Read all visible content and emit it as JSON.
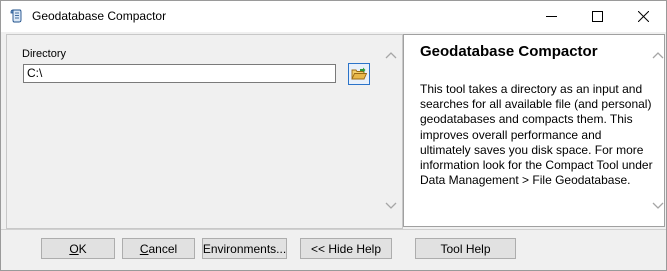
{
  "window": {
    "title": "Geodatabase Compactor",
    "controls": {
      "minimize": "minimize",
      "maximize": "maximize",
      "close": "close"
    }
  },
  "form": {
    "directory_label": "Directory",
    "directory_value": "C:\\",
    "browse_icon": "folder-open-icon"
  },
  "help": {
    "title": "Geodatabase Compactor",
    "body": "This tool takes a directory as an input and searches for all available file (and personal) geodatabases and compacts them. This improves overall performance and ultimately saves you disk space. For more information look for the Compact Tool under Data Management > File Geodatabase."
  },
  "buttons": {
    "ok_first": "O",
    "ok_rest": "K",
    "cancel_first": "C",
    "cancel_rest": "ancel",
    "environments": "Environments...",
    "hide_help": "<< Hide Help",
    "tool_help": "Tool Help"
  },
  "colors": {
    "accent": "#2a73c9",
    "folder": "#e8b84a"
  }
}
